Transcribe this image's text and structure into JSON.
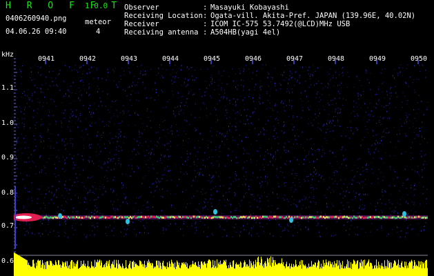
{
  "header": {
    "app_title": "H R O F F T",
    "app_version": "1.0.0",
    "filename": "0406260940.png",
    "datetime": "04.06.26 09:40",
    "meteor_label": "meteor",
    "meteor_count": "4",
    "info": [
      {
        "key": "Observer",
        "value": "Masayuki Kobayashi"
      },
      {
        "key": "Receiving Location",
        "value": "Ogata-vill. Akita-Pref. JAPAN (139.96E, 40.02N)"
      },
      {
        "key": "Receiver",
        "value": "ICOM IC-575 53.7492(@LCD)MHz USB"
      },
      {
        "key": "Receiving antenna",
        "value": "A504HB(yagi 4el)"
      }
    ]
  },
  "spectrogram": {
    "unit": "kHz",
    "y_ticks": [
      "1.1",
      "1.0",
      "0.9",
      "0.8",
      "0.7",
      "0.6"
    ],
    "time_ticks": [
      "0941",
      "0942",
      "0943",
      "0944",
      "0945",
      "0946",
      "0947",
      "0948",
      "0949",
      "0950"
    ],
    "signal_freq_khz": 0.73,
    "colors": {
      "background": "#000000",
      "noise": "#1a1a8c",
      "signal_line": "#e03060",
      "signal_core": "#ffffff",
      "activity": "#ffff00"
    }
  }
}
